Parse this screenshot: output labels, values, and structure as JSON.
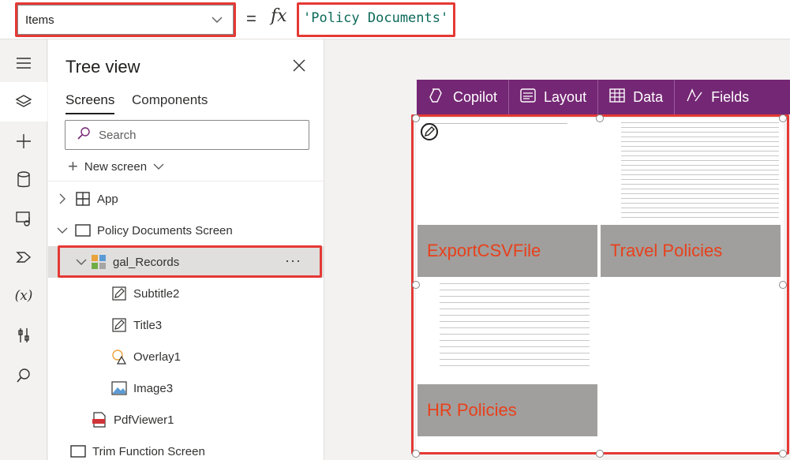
{
  "formula_bar": {
    "property": "Items",
    "equals": "=",
    "fx": "fx",
    "formula": "'Policy Documents'"
  },
  "rail": {
    "icons": [
      "hamburger-icon",
      "layers-icon",
      "plus-icon",
      "database-icon",
      "media-icon",
      "shapes-icon",
      "variable-icon",
      "tools-icon",
      "search-icon"
    ],
    "variable_label": "(x)"
  },
  "tree": {
    "title": "Tree view",
    "tabs": [
      "Screens",
      "Components"
    ],
    "search_placeholder": "Search",
    "new_screen": "New screen",
    "items": [
      {
        "label": "App"
      },
      {
        "label": "Policy Documents Screen"
      },
      {
        "label": "gal_Records",
        "more": "···"
      },
      {
        "label": "Subtitle2"
      },
      {
        "label": "Title3"
      },
      {
        "label": "Overlay1"
      },
      {
        "label": "Image3"
      },
      {
        "label": "PdfViewer1"
      },
      {
        "label": "Trim Function Screen"
      }
    ]
  },
  "toolbar": {
    "items": [
      {
        "label": "Copilot"
      },
      {
        "label": "Layout"
      },
      {
        "label": "Data"
      },
      {
        "label": "Fields"
      }
    ]
  },
  "gallery": {
    "captions": [
      "ExportCSVFile",
      "Travel Policies",
      "HR Policies"
    ]
  },
  "colors": {
    "accent": "#742774",
    "highlight": "#e53935",
    "caption": "#e8401c",
    "formula": "#0b6a5a"
  }
}
